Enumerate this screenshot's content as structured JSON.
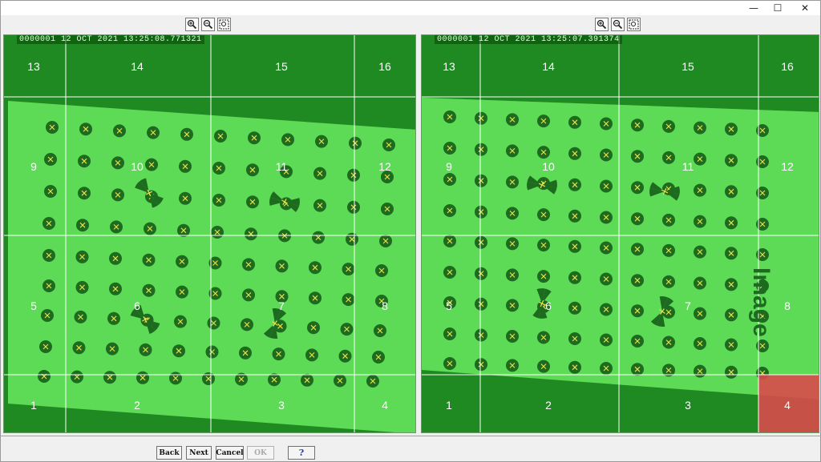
{
  "window": {
    "controls": {
      "minimize": "—",
      "maximize": "☐",
      "close": "✕"
    }
  },
  "left_pane": {
    "timestamp": "0000001 12 OCT 2021 13:25:08.771321",
    "cell_numbers": [
      "13",
      "14",
      "15",
      "16",
      "9",
      "10",
      "11",
      "12",
      "5",
      "6",
      "7",
      "8",
      "1",
      "2",
      "3",
      "4"
    ]
  },
  "right_pane": {
    "timestamp": "0000001 12 OCT 2021 13:25:07.391374",
    "cell_numbers": [
      "13",
      "14",
      "15",
      "16",
      "9",
      "10",
      "11",
      "12",
      "5",
      "6",
      "7",
      "8",
      "1",
      "2",
      "3",
      "4"
    ],
    "watermark": "Image",
    "highlighted_cell": "4"
  },
  "toolbar": {
    "zoom_in": "zoom-in-icon",
    "zoom_out": "zoom-out-icon",
    "fit": "fit-to-window-icon"
  },
  "buttons": {
    "back": "Back",
    "next": "Next",
    "cancel": "Cancel",
    "ok": "OK",
    "help": "?"
  },
  "colors": {
    "overlay_green": "#2fae2f",
    "highlight_red": "#d84a4a",
    "grid_line": "#ffffff"
  }
}
